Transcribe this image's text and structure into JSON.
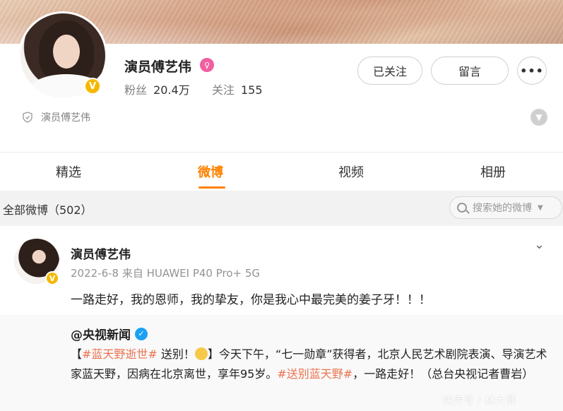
{
  "profile": {
    "name": "演员傅艺伟",
    "fans_label": "粉丝",
    "fans_value": "20.4万",
    "follow_label": "关注",
    "follow_value": "155",
    "verified_text": "演员傅艺伟"
  },
  "actions": {
    "followed_label": "已关注",
    "message_label": "留言",
    "more_label": "•••"
  },
  "tabs": [
    {
      "label": "精选",
      "active": false
    },
    {
      "label": "微博",
      "active": true
    },
    {
      "label": "视频",
      "active": false
    },
    {
      "label": "相册",
      "active": false
    }
  ],
  "filter": {
    "title": "全部微博（502）",
    "search_placeholder": "搜索她的微博"
  },
  "post": {
    "author": "演员傅艺伟",
    "meta": "2022-6-8 来自 HUAWEI P40 Pro+ 5G",
    "text": "一路走好，我的恩师，我的挚友，你是我心中最完美的姜子牙！！！",
    "repost": {
      "author": "@央视新闻",
      "bracket_open": "【",
      "tag1": "#蓝天野逝世#",
      "text1": " 送别！",
      "text2": "】今天下午，“七一勋章”获得者，北京人民艺术剧院表演、导演艺术家蓝天野，因病在北京离世，享年95岁。",
      "tag2": "#送别蓝天野#",
      "text3": "，一路走好！（总台央视记者曹岩）"
    }
  },
  "watermark": "快传号 / 林大师",
  "colors": {
    "accent": "#ff8200",
    "tag": "#eb7350",
    "verified_gold": "#f5b800",
    "verified_blue": "#1da1f2"
  }
}
